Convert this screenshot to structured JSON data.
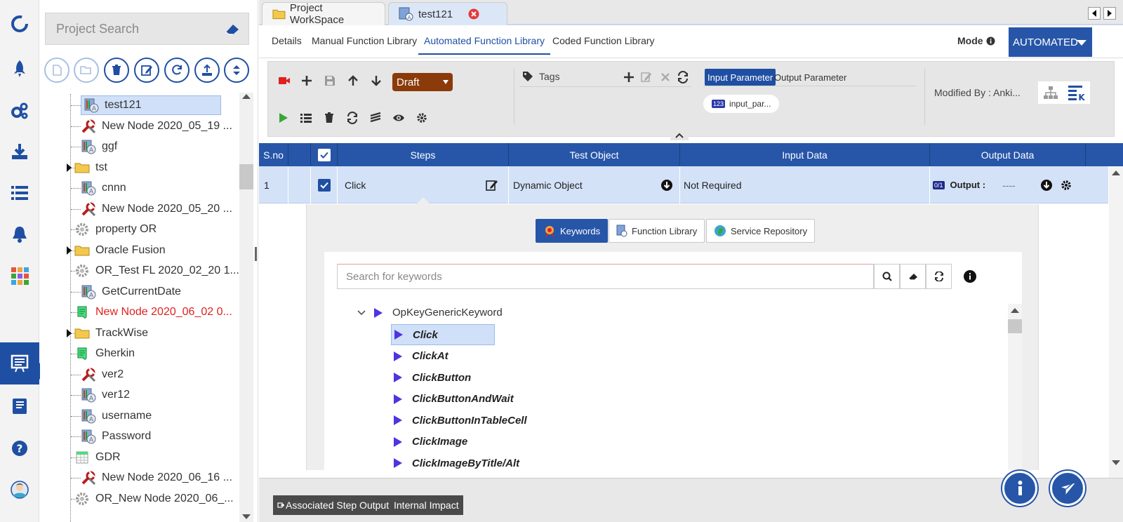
{
  "colors": {
    "brand": "#1f4fa3",
    "header_blue": "#2756a8",
    "draft_brown": "#8b3a0a",
    "record_red": "#e0201f",
    "run_green": "#3aa63a",
    "red_text": "#e02020"
  },
  "nav": {
    "items": [
      "logo-icon",
      "rocket-icon",
      "gears-icon",
      "download-icon",
      "list-icon",
      "bell-icon",
      "apps-grid-icon",
      "function-library-icon",
      "book-icon",
      "help-icon",
      "user-avatar-icon"
    ]
  },
  "tree": {
    "search_placeholder": "Project Search",
    "items": [
      {
        "label": "test121"
      },
      {
        "label": "New Node 2020_05_19 ..."
      },
      {
        "label": "ggf"
      },
      {
        "label": "tst"
      },
      {
        "label": "cnnn"
      },
      {
        "label": "New Node 2020_05_20 ..."
      },
      {
        "label": "property OR"
      },
      {
        "label": "Oracle Fusion"
      },
      {
        "label": "OR_Test FL 2020_02_20 1..."
      },
      {
        "label": "GetCurrentDate"
      },
      {
        "label": "New Node 2020_06_02 0..."
      },
      {
        "label": "TrackWise"
      },
      {
        "label": "Gherkin"
      },
      {
        "label": "ver2"
      },
      {
        "label": "ver12"
      },
      {
        "label": "username"
      },
      {
        "label": "Password"
      },
      {
        "label": "GDR"
      },
      {
        "label": "New Node 2020_06_16 ..."
      },
      {
        "label": "OR_New Node 2020_06_..."
      }
    ]
  },
  "tabs": {
    "workspace": "Project WorkSpace",
    "active": "test121"
  },
  "subtabs": {
    "details": "Details",
    "manual": "Manual Function Library",
    "automated": "Automated Function Library",
    "coded": "Coded Function Library"
  },
  "mode": {
    "label": "Mode",
    "value": "AUTOMATED"
  },
  "toolbar": {
    "status": "Draft",
    "tags_label": "Tags",
    "input_param_tab": "Input Parameter",
    "output_param_tab": "Output Parameter",
    "param_pill": "input_par...",
    "param_type": "123",
    "modified_by": "Modified By : Anki..."
  },
  "grid": {
    "headers": {
      "sno": "S.no",
      "steps": "Steps",
      "test_object": "Test Object",
      "input_data": "Input Data",
      "output_data": "Output Data"
    },
    "row": {
      "sno": "1",
      "step": "Click",
      "test_object": "Dynamic Object",
      "input_data": "Not Required",
      "output_label": "Output :",
      "output_value": "----",
      "output_type": "0/1"
    }
  },
  "keyword_panel": {
    "tabs": [
      "Keywords",
      "Function Library",
      "Service Repository"
    ],
    "search_placeholder": "Search for keywords",
    "group": "OpKeyGenericKeyword",
    "items": [
      "Click",
      "ClickAt",
      "ClickButton",
      "ClickButtonAndWait",
      "ClickButtonInTableCell",
      "ClickImage",
      "ClickImageByTitle/Alt"
    ]
  },
  "bottom": {
    "assoc": "Associated Step Output",
    "impact": "Internal Impact"
  }
}
